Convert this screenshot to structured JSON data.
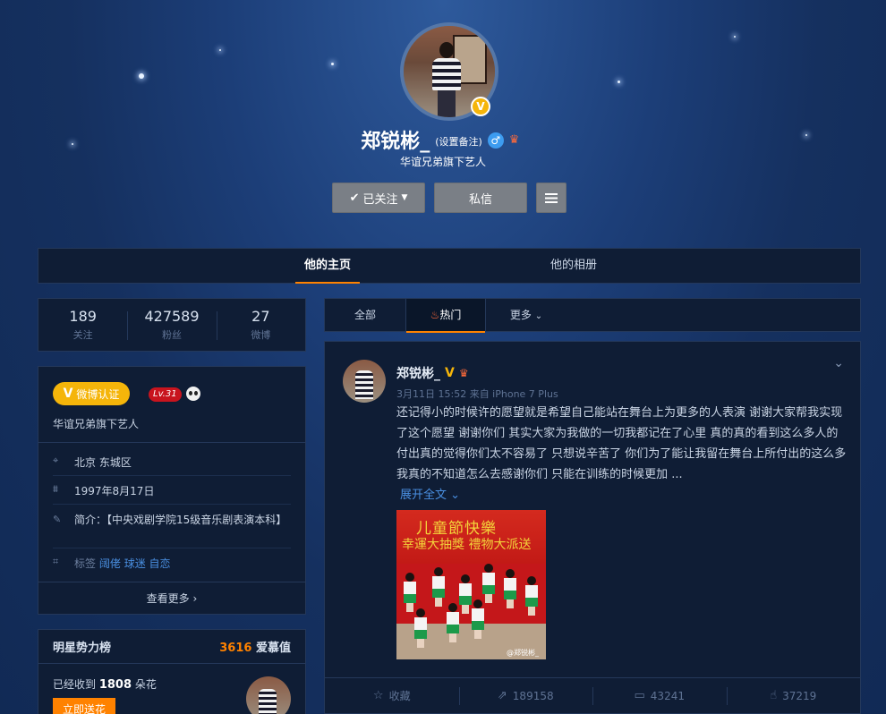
{
  "profile": {
    "name": "郑锐彬_",
    "remark_label": "(设置备注)",
    "bio": "华谊兄弟旗下艺人",
    "gender_icon": "male-icon",
    "verified_icon": "verified-v-icon"
  },
  "actions": {
    "follow_label": "已关注",
    "message_label": "私信"
  },
  "tabs": {
    "home": "他的主页",
    "album": "他的相册"
  },
  "stats": [
    {
      "value": "189",
      "label": "关注"
    },
    {
      "value": "427589",
      "label": "粉丝"
    },
    {
      "value": "27",
      "label": "微博"
    }
  ],
  "info": {
    "cert_label": "微博认证",
    "level": "Lv.31",
    "bio": "华谊兄弟旗下艺人",
    "location": "北京 东城区",
    "birthday": "1997年8月17日",
    "intro": "简介：【中央戏剧学院15级音乐剧表演本科】",
    "tags_label": "标签",
    "tags": [
      "阔佬",
      "球迷",
      "自恋"
    ],
    "more_label": "查看更多"
  },
  "rank": {
    "title": "明星势力榜",
    "score": "3616",
    "score_unit": "爱慕值",
    "received_prefix": "已经收到",
    "received_count": "1808",
    "received_suffix": "朵花",
    "send_label": "立即送花"
  },
  "filter": {
    "all": "全部",
    "hot": "热门",
    "more": "更多"
  },
  "post": {
    "author": "郑锐彬_",
    "meta": "3月11日 15:52 来自 iPhone 7 Plus",
    "text": "还记得小的时候许的愿望就是希望自己能站在舞台上为更多的人表演 谢谢大家帮我实现了这个愿望 谢谢你们 其实大家为我做的一切我都记在了心里 真的真的看到这么多人的付出真的觉得你们太不容易了 只想说辛苦了 你们为了能让我留在舞台上所付出的这么多我真的不知道怎么去感谢你们 只能在训练的时候更加 ...",
    "expand_label": "展开全文",
    "photo": {
      "title": "儿童節快樂",
      "subtitle": "幸運大抽獎 禮物大派送",
      "watermark": "@郑锐彬_"
    },
    "actions": {
      "favorite": "收藏",
      "repost": "189158",
      "comment": "43241",
      "like": "37219"
    }
  },
  "colors": {
    "accent": "#ff8200",
    "verified": "#f5b50a",
    "link": "#4a90e2",
    "panel": "#0f1d35"
  }
}
